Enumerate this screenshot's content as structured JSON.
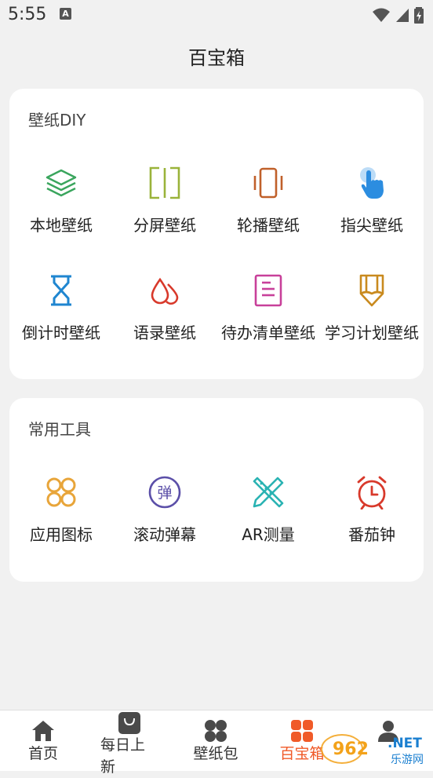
{
  "status": {
    "time": "5:55",
    "notif_badge": "A"
  },
  "page": {
    "title": "百宝箱"
  },
  "sections": [
    {
      "title": "壁纸DIY",
      "items": [
        {
          "label": "本地壁纸",
          "icon": "layers-icon",
          "color": "#3aa55d"
        },
        {
          "label": "分屏壁纸",
          "icon": "split-screen-icon",
          "color": "#9ab33a"
        },
        {
          "label": "轮播壁纸",
          "icon": "carousel-icon",
          "color": "#c0602a"
        },
        {
          "label": "指尖壁纸",
          "icon": "finger-tap-icon",
          "color": "#2c8de0"
        },
        {
          "label": "倒计时壁纸",
          "icon": "hourglass-icon",
          "color": "#1f86d0"
        },
        {
          "label": "语录壁纸",
          "icon": "drops-icon",
          "color": "#d8392b"
        },
        {
          "label": "待办清单壁纸",
          "icon": "checklist-icon",
          "color": "#c8409a"
        },
        {
          "label": "学习计划壁纸",
          "icon": "pencil-icon",
          "color": "#c98a1e"
        }
      ]
    },
    {
      "title": "常用工具",
      "items": [
        {
          "label": "应用图标",
          "icon": "app-grid-icon",
          "color": "#e8a53a"
        },
        {
          "label": "滚动弹幕",
          "icon": "danmaku-icon",
          "color": "#5b4fa8",
          "glyph": "弹"
        },
        {
          "label": "AR测量",
          "icon": "ruler-pencil-icon",
          "color": "#2ab3b3"
        },
        {
          "label": "番茄钟",
          "icon": "alarm-clock-icon",
          "color": "#d8392b"
        }
      ]
    }
  ],
  "tabbar": {
    "tabs": [
      {
        "label": "首页",
        "icon": "home-icon"
      },
      {
        "label": "每日上新",
        "icon": "shopping-bag-icon"
      },
      {
        "label": "壁纸包",
        "icon": "four-dots-icon"
      },
      {
        "label": "百宝箱",
        "icon": "four-dots-icon",
        "active": true
      },
      {
        "label": "",
        "icon": "profile-icon"
      }
    ],
    "active_color": "#f05a28",
    "inactive_icon_color": "#4a4a4a"
  },
  "watermark": {
    "text": "962",
    "suffix": ".NET",
    "sub": "乐游网"
  }
}
